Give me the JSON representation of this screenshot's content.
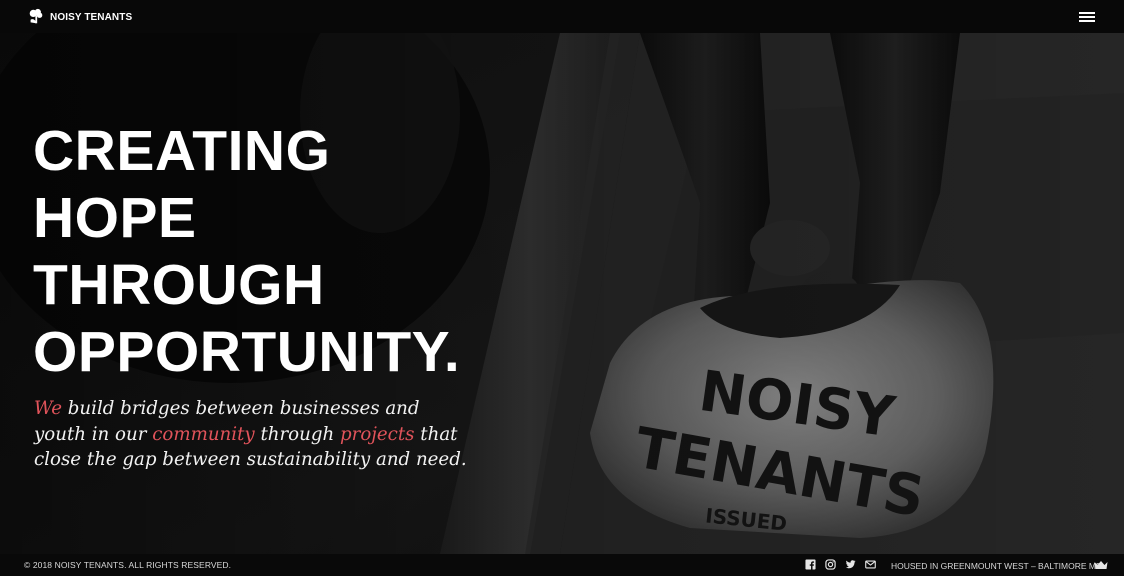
{
  "header": {
    "brand": "NOISY TENANTS",
    "logo_icon": "tree-hand-logo",
    "menu_icon": "hamburger-menu-icon"
  },
  "hero": {
    "headline_lines": [
      "CREATING",
      "HOPE",
      "THROUGH",
      "OPPORTUNITY."
    ],
    "tagline": {
      "w1": "We",
      "t1": " build bridges between businesses and youth in our ",
      "w2": "community",
      "t2": " through ",
      "w3": "projects",
      "t3": " that close the gap between sustainability and need."
    },
    "background_image_text": [
      "NOISY",
      "TENANTS",
      "ISSUED"
    ]
  },
  "footer": {
    "copyright": "© 2018 NOISY TENANTS. ALL RIGHTS RESERVED.",
    "social_icons": [
      "facebook-icon",
      "instagram-icon",
      "twitter-icon",
      "email-icon"
    ],
    "location": "HOUSED IN GREENMOUNT WEST – BALTIMORE MD",
    "crown_icon": "crown-icon"
  },
  "colors": {
    "accent": "#e0535a",
    "text": "#ffffff",
    "bar": "#080808"
  }
}
